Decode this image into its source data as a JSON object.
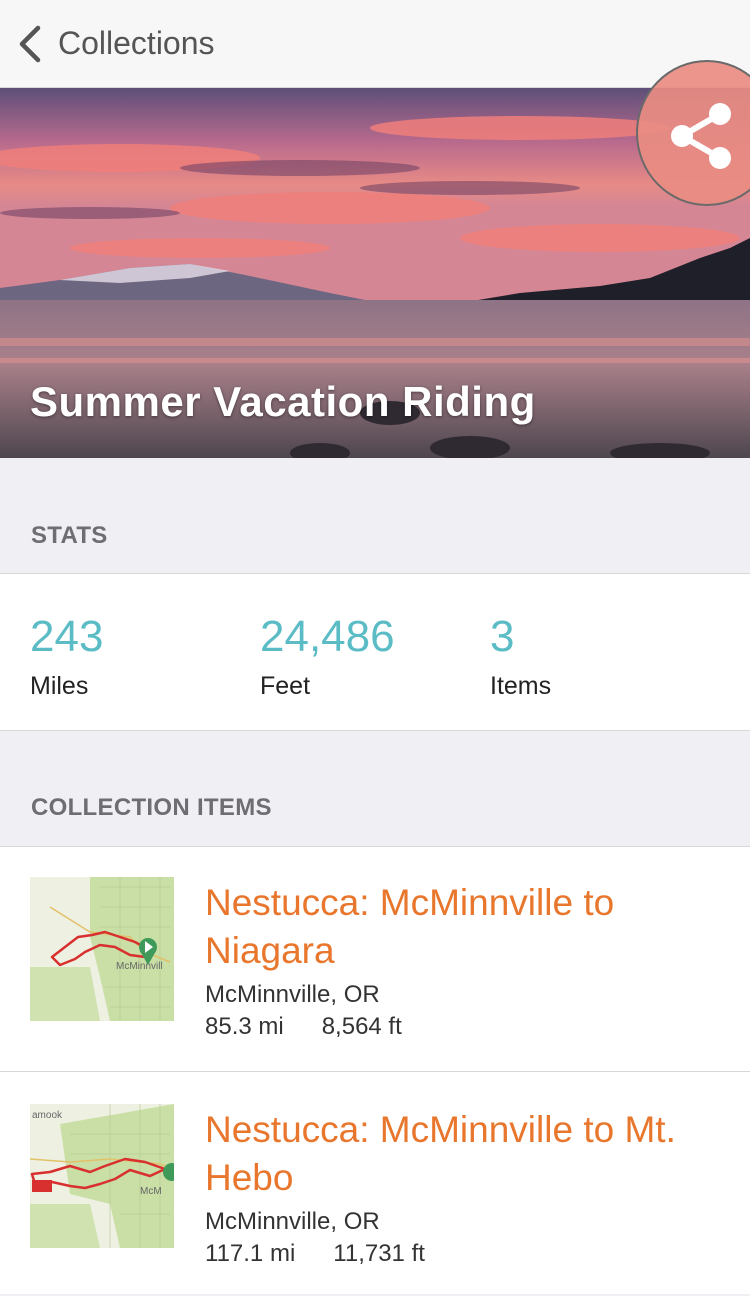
{
  "nav": {
    "back_label": "Collections"
  },
  "hero": {
    "title": "Summer Vacation Riding"
  },
  "stats_section": {
    "heading": "STATS",
    "stats": [
      {
        "value": "243",
        "label": "Miles"
      },
      {
        "value": "24,486",
        "label": "Feet"
      },
      {
        "value": "3",
        "label": "Items"
      }
    ]
  },
  "items_section": {
    "heading": "COLLECTION ITEMS",
    "items": [
      {
        "title": "Nestucca: McMinnville to Niagara",
        "location": "McMinnville, OR",
        "distance": "85.3 mi",
        "elevation": "8,564 ft",
        "map_label": "McMinnvill"
      },
      {
        "title": "Nestucca: McMinnville to Mt. Hebo",
        "location": "McMinnville, OR",
        "distance": "117.1 mi",
        "elevation": "11,731 ft",
        "map_label": "McM"
      }
    ]
  },
  "icons": {
    "back": "chevron-left-icon",
    "share": "share-icon",
    "start_marker": "map-start-marker-icon"
  },
  "colors": {
    "accent_teal": "#5bbcc6",
    "title_orange": "#e8762c",
    "route_red": "#d8302f"
  }
}
